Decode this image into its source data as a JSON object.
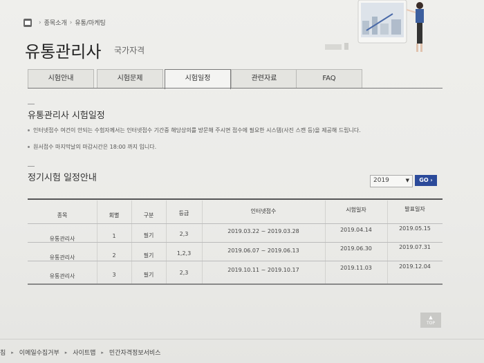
{
  "breadcrumb": {
    "items": [
      "종목소개",
      "유통/마케팅"
    ]
  },
  "page": {
    "title": "유통관리사",
    "subtitle": "국가자격"
  },
  "tabs": [
    "시험안내",
    "시험문제",
    "시험일정",
    "관련자료",
    "FAQ"
  ],
  "active_tab": "시험일정",
  "section1": {
    "title": "유통관리사 시험일정",
    "notes": [
      "인터넷접수 여건이 안되는 수험자께서는 인터넷접수 기간중 해당상의를 방문해 주시면 접수에 필요한 시스템(사진 스캔 등)을 제공해 드립니다.",
      "원서접수 마지막날의 마감시간은 18:00 까지 입니다."
    ]
  },
  "section2": {
    "title": "정기시험 일정안내"
  },
  "year_select": {
    "value": "2019"
  },
  "go_button": {
    "label": "GO",
    "color": "#2b4a9a"
  },
  "table": {
    "headers": [
      "종목",
      "회별",
      "구분",
      "등급",
      "인터넷접수",
      "시험일자",
      "발표일자"
    ],
    "rows": [
      [
        "유통관리사",
        "1",
        "필기",
        "2,3",
        "2019.03.22 ~ 2019.03.28",
        "2019.04.14",
        "2019.05.15"
      ],
      [
        "유통관리사",
        "2",
        "필기",
        "1,2,3",
        "2019.06.07 ~ 2019.06.13",
        "2019.06.30",
        "2019.07.31"
      ],
      [
        "유통관리사",
        "3",
        "필기",
        "2,3",
        "2019.10.11 ~ 2019.10.17",
        "2019.11.03",
        "2019.12.04"
      ]
    ]
  },
  "top_button": {
    "label": "TOP"
  },
  "footer": {
    "items": [
      "침",
      "이메일수집거부",
      "사이트맵",
      "민간자격정보서비스"
    ]
  }
}
